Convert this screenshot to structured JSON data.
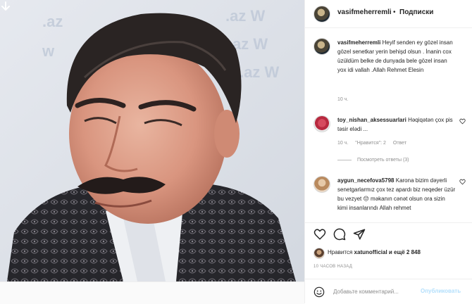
{
  "post": {
    "author": "vasifmeherremli",
    "separator": "•",
    "subscribe_label": "Подписки"
  },
  "comments": [
    {
      "username": "vasifmeherremli",
      "text": "Heyif senden ey gözel insan gözel senetkar yerin behişd olsun . İnanin cox üzüldüm belke de dunyada bele gözel insan yox idi vallah .Allah Rehmet Elesin",
      "time": "10 ч.",
      "avatar": "profile-avatar"
    },
    {
      "username": "toy_nishan_aksessuarlari",
      "text": "Həqiqətən çox pis təsir elədi ...",
      "time": "10 ч.",
      "likes": "\"Нравится\": 2",
      "reply_label": "Ответ",
      "view_replies": "Посмотреть ответы (3)",
      "avatar": "flowers-avatar"
    },
    {
      "username": "aygun_necefova5798",
      "text": "Karona bizim dəyerli senetgarlarmız çox tez apardı biz neqeder üzür bu vezyet 😔 məkanın cənət olsun ora sizin kimi insanlarındı Allah rehmet",
      "avatar": "woman-avatar"
    }
  ],
  "likes": {
    "prefix": "Нравится",
    "user": "xatunofficial",
    "suffix": "и ещё 2 848"
  },
  "time_ago": "10 ЧАСОВ НАЗАД",
  "add_comment": {
    "placeholder": "Добавьте комментарий...",
    "post_label": "Опубликовать"
  },
  "colors": {
    "accent_blue": "#0095f6",
    "disabled_blue": "#b2dffc",
    "muted_text": "#8e8e8e",
    "border": "#efefef"
  },
  "icons": [
    "arrow-down-icon",
    "heart-icon",
    "comment-icon",
    "share-icon",
    "emoji-icon"
  ]
}
